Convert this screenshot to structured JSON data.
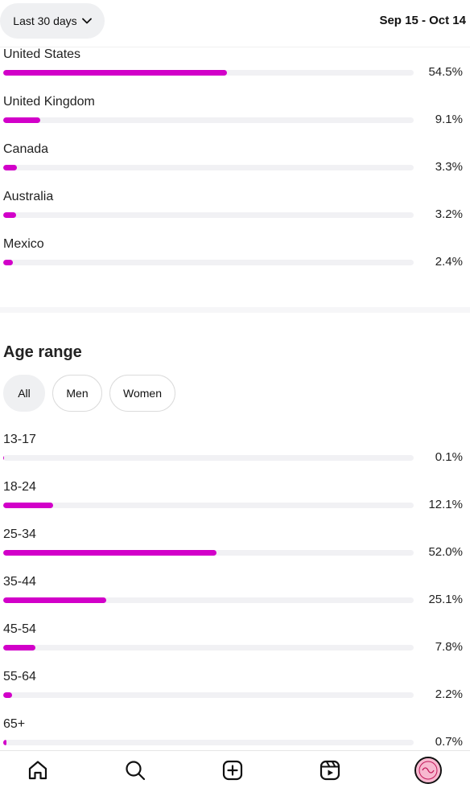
{
  "header": {
    "range_label": "Last 30 days",
    "date_range": "Sep 15 - Oct 14"
  },
  "countries": [
    {
      "label": "United States",
      "value": 54.5,
      "display": "54.5%"
    },
    {
      "label": "United Kingdom",
      "value": 9.1,
      "display": "9.1%"
    },
    {
      "label": "Canada",
      "value": 3.3,
      "display": "3.3%"
    },
    {
      "label": "Australia",
      "value": 3.2,
      "display": "3.2%"
    },
    {
      "label": "Mexico",
      "value": 2.4,
      "display": "2.4%"
    }
  ],
  "age": {
    "title": "Age range",
    "filters": [
      {
        "label": "All",
        "active": true
      },
      {
        "label": "Men",
        "active": false
      },
      {
        "label": "Women",
        "active": false
      }
    ],
    "ranges": [
      {
        "label": "13-17",
        "value": 0.1,
        "display": "0.1%"
      },
      {
        "label": "18-24",
        "value": 12.1,
        "display": "12.1%"
      },
      {
        "label": "25-34",
        "value": 52.0,
        "display": "52.0%"
      },
      {
        "label": "35-44",
        "value": 25.1,
        "display": "25.1%"
      },
      {
        "label": "45-54",
        "value": 7.8,
        "display": "7.8%"
      },
      {
        "label": "55-64",
        "value": 2.2,
        "display": "2.2%"
      },
      {
        "label": "65+",
        "value": 0.7,
        "display": "0.7%"
      }
    ]
  },
  "bottom_nav": {
    "items": [
      {
        "icon": "home-icon"
      },
      {
        "icon": "search-icon"
      },
      {
        "icon": "create-icon"
      },
      {
        "icon": "reels-icon"
      },
      {
        "icon": "profile-avatar"
      }
    ]
  },
  "colors": {
    "bar_fill": "#d200c9",
    "bar_track": "#f1f1f4",
    "chip_active_bg": "#eff0f2"
  }
}
